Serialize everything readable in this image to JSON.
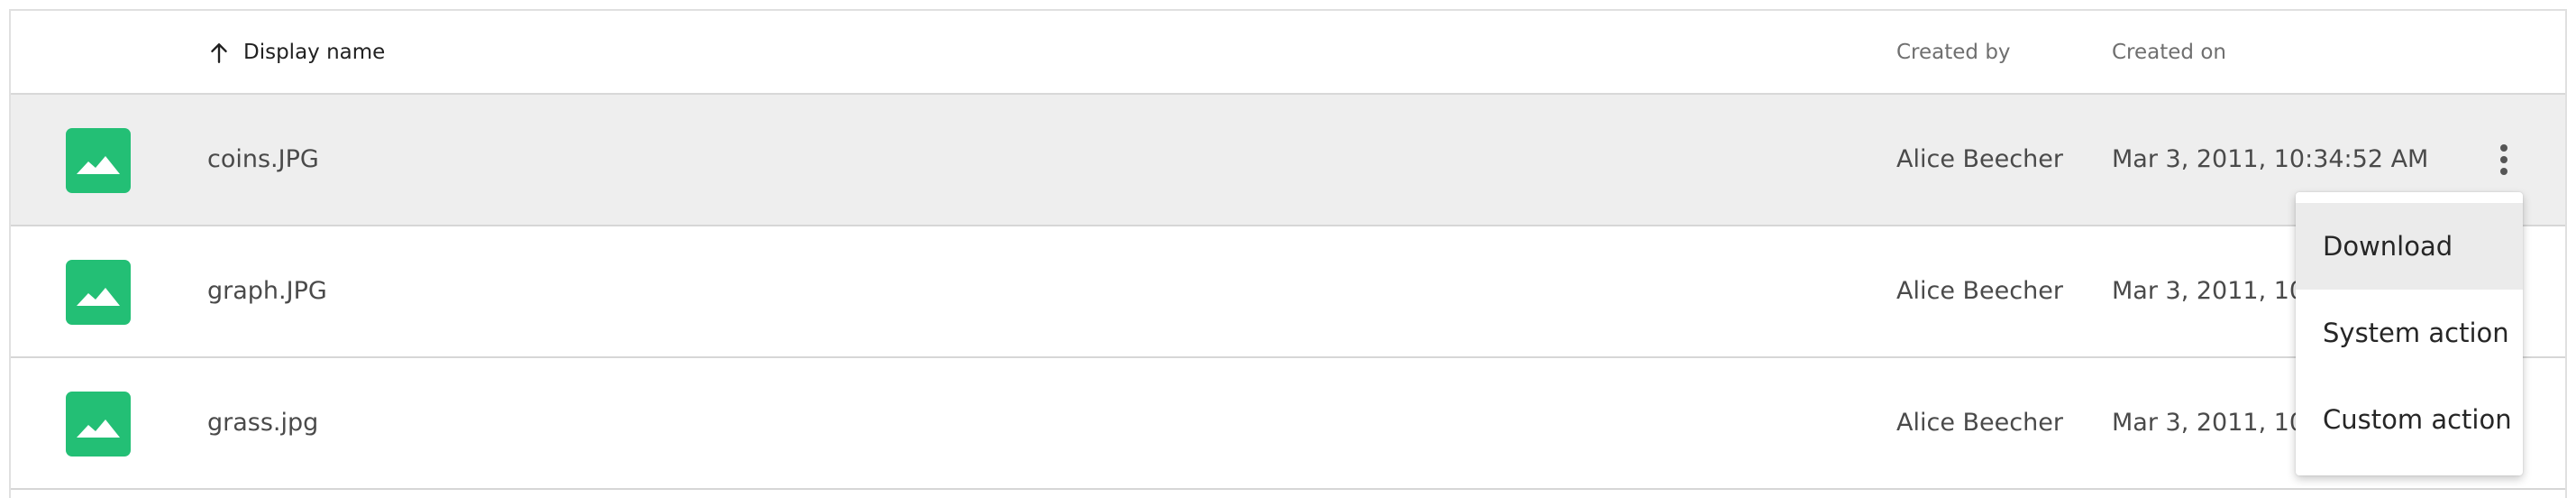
{
  "table": {
    "columns": {
      "display_name": "Display name",
      "created_by": "Created by",
      "created_on": "Created on"
    },
    "sort": {
      "column": "display_name",
      "direction": "ascending",
      "icon": "arrow-up-icon"
    },
    "rows": [
      {
        "name": "coins.JPG",
        "created_by": "Alice Beecher",
        "created_on": "Mar 3, 2011, 10:34:52 AM",
        "selected": true,
        "icon": "image-file-icon"
      },
      {
        "name": "graph.JPG",
        "created_by": "Alice Beecher",
        "created_on": "Mar 3, 2011, 10:",
        "selected": false,
        "icon": "image-file-icon"
      },
      {
        "name": "grass.jpg",
        "created_by": "Alice Beecher",
        "created_on": "Mar 3, 2011, 10:",
        "selected": false,
        "icon": "image-file-icon"
      }
    ]
  },
  "context_menu": {
    "items": [
      "Download",
      "System action",
      "Custom action"
    ],
    "highlighted": "Download"
  },
  "colors": {
    "thumbnail": "#23bf75",
    "selected_row": "#eeeeee",
    "menu_hover": "#ebebeb"
  }
}
